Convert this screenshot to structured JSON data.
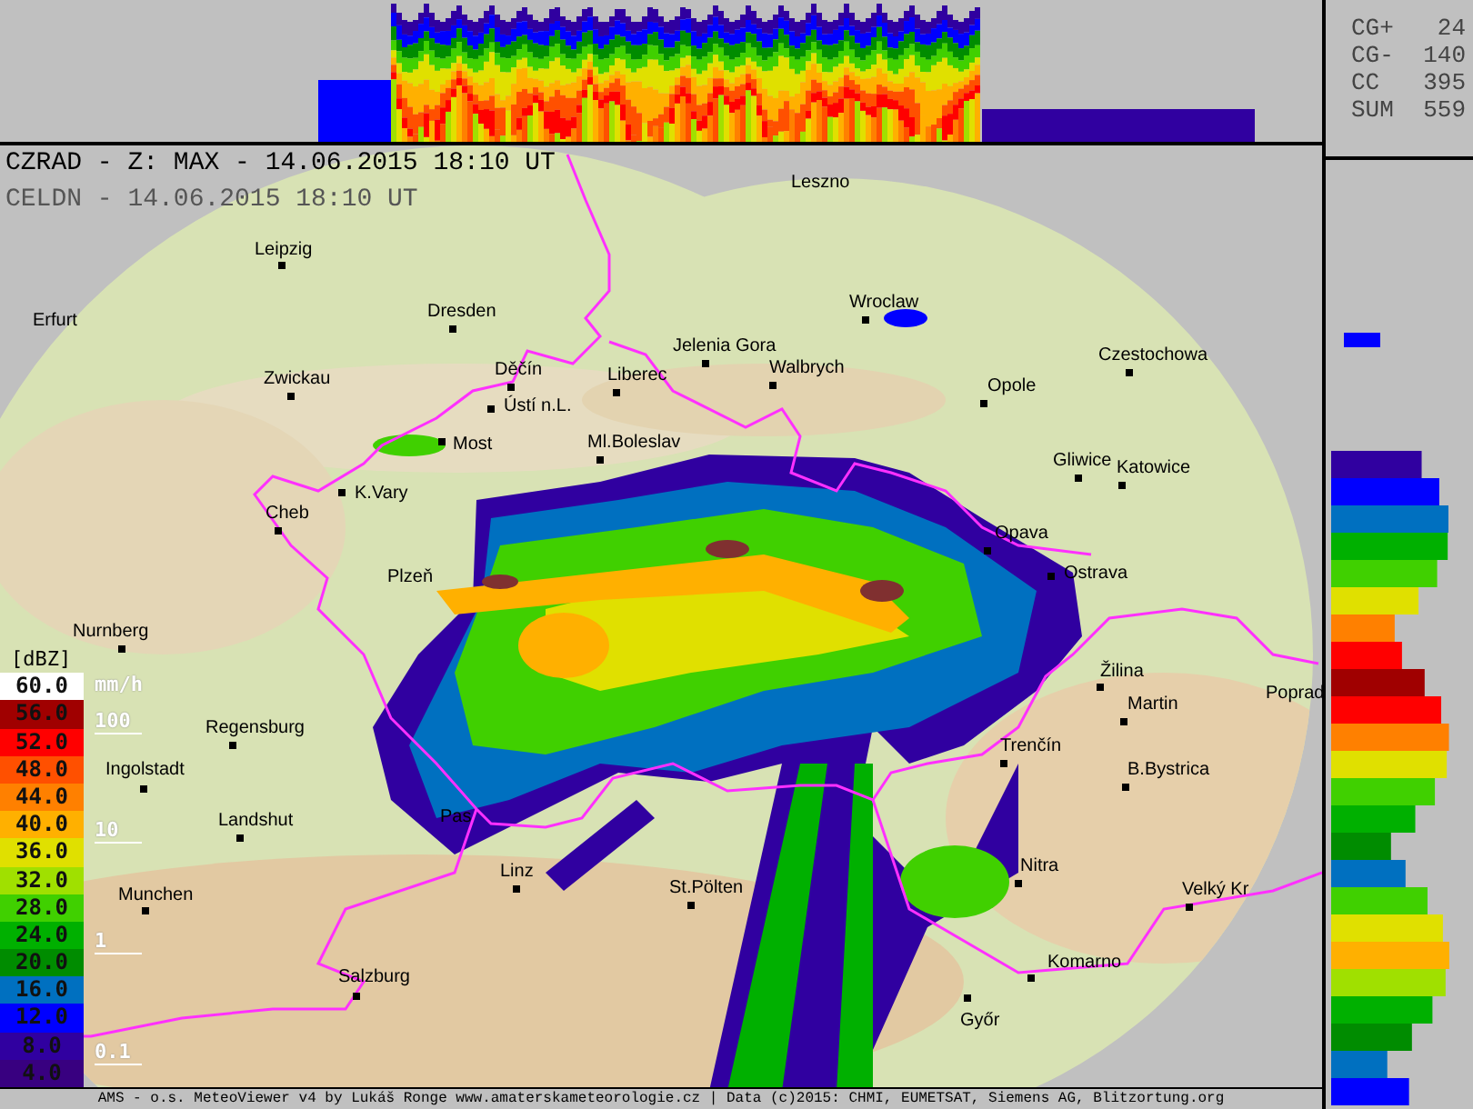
{
  "header": {
    "title": "CZRAD - Z: MAX - 14.06.2015 18:10 UT",
    "subtitle": "CELDN - 14.06.2015 18:10 UT"
  },
  "lightning_stats": [
    {
      "label": "CG+",
      "value": "24"
    },
    {
      "label": "CG-",
      "value": "140"
    },
    {
      "label": "CC",
      "value": "395"
    },
    {
      "label": "SUM",
      "value": "559"
    }
  ],
  "cities": [
    {
      "name": "Leszno"
    },
    {
      "name": "Leipzig"
    },
    {
      "name": "Dresden"
    },
    {
      "name": "Wroclaw"
    },
    {
      "name": "Erfurt"
    },
    {
      "name": "Jelenia Gora"
    },
    {
      "name": "Zwickau"
    },
    {
      "name": "Děčín"
    },
    {
      "name": "Liberec"
    },
    {
      "name": "Walbrych"
    },
    {
      "name": "Opole"
    },
    {
      "name": "Czestochowa"
    },
    {
      "name": "Ústí n.L."
    },
    {
      "name": "Ml.Boleslav"
    },
    {
      "name": "Most"
    },
    {
      "name": "Gliwice"
    },
    {
      "name": "Katowice"
    },
    {
      "name": "K.Vary"
    },
    {
      "name": "Cheb"
    },
    {
      "name": "Opava"
    },
    {
      "name": "Plzeň"
    },
    {
      "name": "Ostrava"
    },
    {
      "name": "Nurnberg"
    },
    {
      "name": "Žilina"
    },
    {
      "name": "Martin"
    },
    {
      "name": "Poprad"
    },
    {
      "name": "Regensburg"
    },
    {
      "name": "Trenčín"
    },
    {
      "name": "Ingolstadt"
    },
    {
      "name": "B.Bystrica"
    },
    {
      "name": "Landshut"
    },
    {
      "name": "Pas"
    },
    {
      "name": "Linz"
    },
    {
      "name": "Nitra"
    },
    {
      "name": "Munchen"
    },
    {
      "name": "St.Pölten"
    },
    {
      "name": "Velký Kr"
    },
    {
      "name": "Komarno"
    },
    {
      "name": "Salzburg"
    },
    {
      "name": "Győr"
    }
  ],
  "legend": {
    "unit": "[dBZ]",
    "rain_unit": "mm/h",
    "rows": [
      {
        "dbz": "60.0",
        "color": "#ffffff"
      },
      {
        "dbz": "56.0",
        "color": "#a00000",
        "rain_rate": "100"
      },
      {
        "dbz": "52.0",
        "color": "#ff0000"
      },
      {
        "dbz": "48.0",
        "color": "#ff5000"
      },
      {
        "dbz": "44.0",
        "color": "#ff8000"
      },
      {
        "dbz": "40.0",
        "color": "#ffb000",
        "rain_rate": "10"
      },
      {
        "dbz": "36.0",
        "color": "#e0e000"
      },
      {
        "dbz": "32.0",
        "color": "#a0e000"
      },
      {
        "dbz": "28.0",
        "color": "#40d000"
      },
      {
        "dbz": "24.0",
        "color": "#00b000",
        "rain_rate": "1"
      },
      {
        "dbz": "20.0",
        "color": "#008c00"
      },
      {
        "dbz": "16.0",
        "color": "#0070c0"
      },
      {
        "dbz": "12.0",
        "color": "#0000ff"
      },
      {
        "dbz": "8.0",
        "color": "#3000a0",
        "rain_rate": "0.1"
      },
      {
        "dbz": "4.0",
        "color": "#380080"
      }
    ]
  },
  "footer": "AMS - o.s. MeteoViewer v4 by Lukáš Ronge www.amaterskameteorologie.cz | Data (c)2015: CHMI, EUMETSAT, Siemens AG, Blitzortung.org"
}
